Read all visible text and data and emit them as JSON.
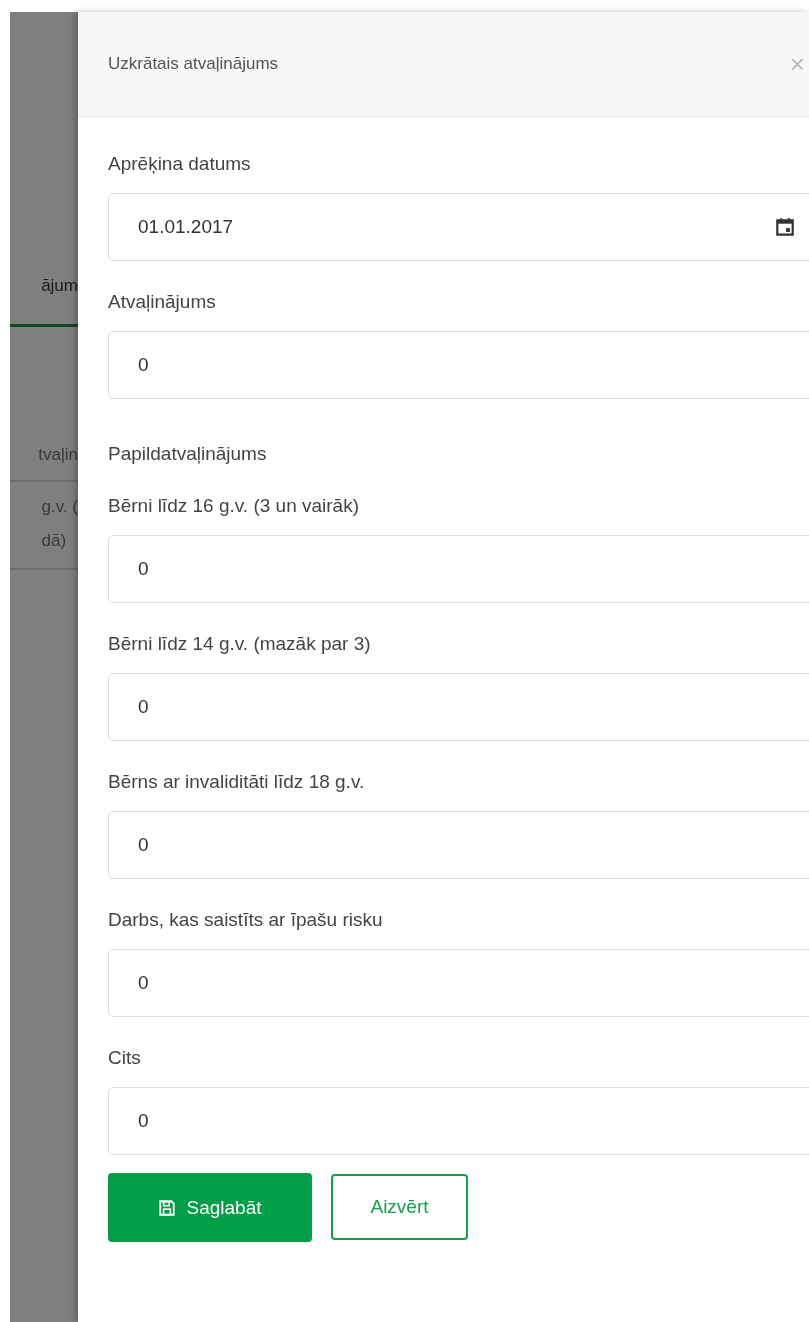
{
  "background_page": {
    "tab": {
      "label": "ājum",
      "selected": true
    },
    "column_header": "tvaļin",
    "cell_lines": [
      "g.v. (",
      "dā)"
    ]
  },
  "dialog": {
    "title": "Uzkrātais atvaļinājums",
    "close": "×",
    "items": [
      {
        "kind": "date",
        "label": "Aprēķina datums",
        "value": "01.01.2017"
      },
      {
        "kind": "number",
        "label": "Atvaļinājums",
        "value": "0"
      },
      {
        "kind": "section",
        "label": "Papildatvaļinājums"
      },
      {
        "kind": "number",
        "label": "Bērni līdz 16 g.v. (3 un vairāk)",
        "value": "0"
      },
      {
        "kind": "number",
        "label": "Bērni līdz 14 g.v. (mazāk par 3)",
        "value": "0"
      },
      {
        "kind": "number",
        "label": "Bērns ar invaliditāti līdz 18 g.v.",
        "value": "0"
      },
      {
        "kind": "number",
        "label": "Darbs, kas saistīts ar īpašu risku",
        "value": "0"
      },
      {
        "kind": "number",
        "label": "Cits",
        "value": "0"
      }
    ],
    "buttons": [
      {
        "kind": "primary",
        "label": "Saglabāt"
      },
      {
        "kind": "secondary",
        "label": "Aizvērt"
      }
    ]
  }
}
